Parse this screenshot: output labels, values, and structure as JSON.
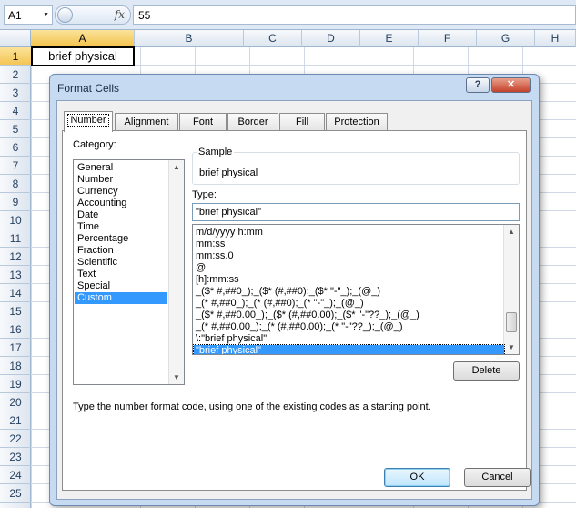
{
  "formula_bar": {
    "name_box": "A1",
    "fx_label": "fx",
    "value": "55"
  },
  "sheet": {
    "columns": [
      "A",
      "B",
      "C",
      "D",
      "E",
      "F",
      "G",
      "H"
    ],
    "rows": [
      "1",
      "2",
      "3",
      "4",
      "5",
      "6",
      "7",
      "8",
      "9",
      "10",
      "11",
      "12",
      "13",
      "14",
      "15",
      "16",
      "17",
      "18",
      "19",
      "20",
      "21",
      "22",
      "23",
      "24",
      "25"
    ],
    "active_cell_value": "brief physical"
  },
  "dialog": {
    "title": "Format Cells",
    "help_glyph": "?",
    "close_glyph": "✕",
    "tabs": [
      "Number",
      "Alignment",
      "Font",
      "Border",
      "Fill",
      "Protection"
    ],
    "category_label": "Category:",
    "categories": [
      "General",
      "Number",
      "Currency",
      "Accounting",
      "Date",
      "Time",
      "Percentage",
      "Fraction",
      "Scientific",
      "Text",
      "Special",
      "Custom"
    ],
    "selected_category": "Custom",
    "sample_label": "Sample",
    "sample_value": "brief physical",
    "type_label": "Type:",
    "type_value": "\"brief physical\"",
    "formats": [
      "m/d/yyyy h:mm",
      "mm:ss",
      "mm:ss.0",
      "@",
      "[h]:mm:ss",
      "_($* #,##0_);_($* (#,##0);_($* \"-\"_);_(@_)",
      "_(* #,##0_);_(* (#,##0);_(* \"-\"_);_(@_)",
      "_($* #,##0.00_);_($* (#,##0.00);_($* \"-\"??_);_(@_)",
      "_(* #,##0.00_);_(* (#,##0.00);_(* \"-\"??_);_(@_)",
      "\\:\"brief physical\"",
      "\"brief physical\""
    ],
    "selected_format": "\"brief physical\"",
    "delete_label": "Delete",
    "description": "Type the number format code, using one of the existing codes as a starting point.",
    "ok_label": "OK",
    "cancel_label": "Cancel"
  }
}
